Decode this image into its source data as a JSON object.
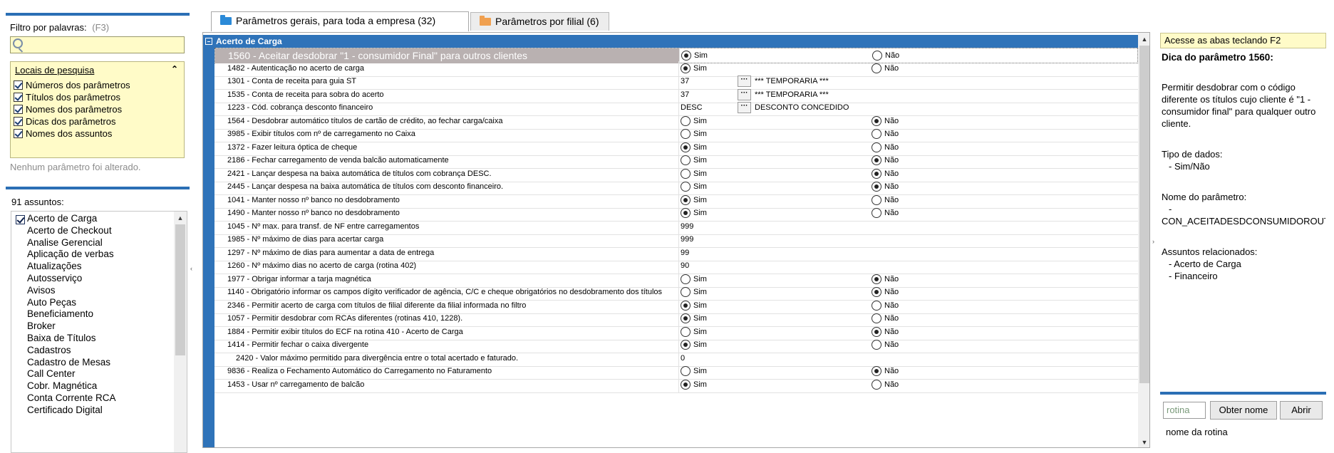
{
  "filter": {
    "label": "Filtro por palavras:",
    "shortcut": "(F3)",
    "value": ""
  },
  "locais": {
    "title": "Locais de pesquisa",
    "items": [
      {
        "label": "Números dos parâmetros",
        "checked": true
      },
      {
        "label": "Títulos dos parâmetros",
        "checked": true
      },
      {
        "label": "Nomes dos parâmetros",
        "checked": true
      },
      {
        "label": "Dicas dos parâmetros",
        "checked": true
      },
      {
        "label": "Nomes dos assuntos",
        "checked": true
      }
    ],
    "status": "Nenhum parâmetro foi alterado."
  },
  "assuntos": {
    "count_label": "91 assuntos:",
    "items": [
      "Acerto de Carga",
      "Acerto de Checkout",
      "Analise Gerencial",
      "Aplicação de verbas",
      "Atualizações",
      "Autosserviço",
      "Avisos",
      "Auto Peças",
      "Beneficiamento",
      "Broker",
      "Baixa de Títulos",
      "Cadastros",
      "Cadastro de Mesas",
      "Call Center",
      "Cobr. Magnética",
      "Conta Corrente RCA",
      "Certificado Digital"
    ]
  },
  "tabs": [
    {
      "label": "Parâmetros gerais, para toda a empresa",
      "count": "(32)",
      "active": true,
      "icon": "folder-blue-icon",
      "color": "#2b8ad8"
    },
    {
      "label": "Parâmetros por filial",
      "count": "(6)",
      "active": false,
      "icon": "folder-orange-icon",
      "color": "#f0a050"
    }
  ],
  "group": {
    "title": "Acerto de Carga"
  },
  "radio_labels": {
    "yes": "Sim",
    "no": "Não"
  },
  "params": [
    {
      "desc": "1560 - Aceitar desdobrar \"1 - consumidor Final\" para outros clientes",
      "type": "bool",
      "value": true,
      "selected": true
    },
    {
      "desc": "1482 - Autenticação no acerto de carga",
      "type": "bool",
      "value": true
    },
    {
      "desc": "1301 - Conta de receita para guia ST",
      "type": "lookup",
      "value": "37",
      "lookup": "*** TEMPORARIA ***"
    },
    {
      "desc": "1535 - Conta de receita para sobra do acerto",
      "type": "lookup",
      "value": "37",
      "lookup": "*** TEMPORARIA ***"
    },
    {
      "desc": "1223 - Cód. cobrança desconto financeiro",
      "type": "lookup",
      "value": "DESC",
      "lookup": "DESCONTO CONCEDIDO"
    },
    {
      "desc": "1564 - Desdobrar automático títulos de cartão de crédito, ao fechar carga/caixa",
      "type": "bool",
      "value": false
    },
    {
      "desc": "3985 - Exibir títulos com nº de carregamento no Caixa",
      "type": "bool",
      "value": null
    },
    {
      "desc": "1372 - Fazer leitura óptica de cheque",
      "type": "bool",
      "value": true
    },
    {
      "desc": "2186 - Fechar carregamento de venda balcão automaticamente",
      "type": "bool",
      "value": false
    },
    {
      "desc": "2421 - Lançar despesa na baixa automática de títulos com cobrança DESC.",
      "type": "bool",
      "value": false
    },
    {
      "desc": "2445 - Lançar despesa na baixa automática de títulos com desconto financeiro.",
      "type": "bool",
      "value": false
    },
    {
      "desc": "1041 - Manter nosso nº banco no desdobramento",
      "type": "bool",
      "value": true
    },
    {
      "desc": "1490 - Manter nosso nº banco no desdobramento",
      "type": "bool",
      "value": true
    },
    {
      "desc": "1045 - Nº max. para transf. de NF entre carregamentos",
      "type": "text",
      "value": "999"
    },
    {
      "desc": "1985 - Nº máximo de dias para acertar carga",
      "type": "text",
      "value": "999"
    },
    {
      "desc": "1297 - Nº máximo de dias para aumentar a data de entrega",
      "type": "text",
      "value": "99"
    },
    {
      "desc": "1260 - Nº máximo dias no acerto de carga (rotina 402)",
      "type": "text",
      "value": "90"
    },
    {
      "desc": "1977 - Obrigar informar a tarja magnética",
      "type": "bool",
      "value": false
    },
    {
      "desc": "1140 - Obrigatório informar os campos dígito verificador de agência, C/C e cheque obrigatórios no desdobramento dos títulos",
      "type": "bool",
      "value": false
    },
    {
      "desc": "2346 - Permitir acerto de carga com títulos de filial diferente da filial informada no filtro",
      "type": "bool",
      "value": true
    },
    {
      "desc": "1057 - Permitir desdobrar com RCAs diferentes (rotinas 410, 1228).",
      "type": "bool",
      "value": true
    },
    {
      "desc": "1884 - Permitir exibir títulos do ECF na rotina 410 - Acerto de Carga",
      "type": "bool",
      "value": false
    },
    {
      "desc": "1414 - Permitir fechar o caixa divergente",
      "type": "bool",
      "value": true
    },
    {
      "desc": "2420 - Valor máximo permitido para divergência entre o total acertado e faturado.",
      "type": "text",
      "value": "0",
      "indent": true
    },
    {
      "desc": "9836 - Realiza o Fechamento Automático do Carregamento no Faturamento",
      "type": "bool",
      "value": false
    },
    {
      "desc": "1453 - Usar nº carregamento de balcão",
      "type": "bool",
      "value": true
    }
  ],
  "help": {
    "tip": "Acesse as abas teclando F2",
    "title": "Dica do parâmetro 1560:",
    "description": "Permitir desdobrar com o código diferente os títulos cujo cliente é \"1 - consumidor final\" para qualquer outro cliente.",
    "tipo_label": "Tipo de dados:",
    "tipo_value": "- Sim/Não",
    "nome_label": "Nome do parâmetro:",
    "nome_dash": "-",
    "nome_value": "CON_ACEITADESDCONSUMIDOROUTROS",
    "assuntos_label": "Assuntos relacionados:",
    "assuntos": [
      "- Acerto de Carga",
      "- Financeiro"
    ]
  },
  "rotina": {
    "placeholder": "rotina",
    "obter_label": "Obter nome",
    "abrir_label": "Abrir",
    "nome_label": "nome da rotina"
  }
}
